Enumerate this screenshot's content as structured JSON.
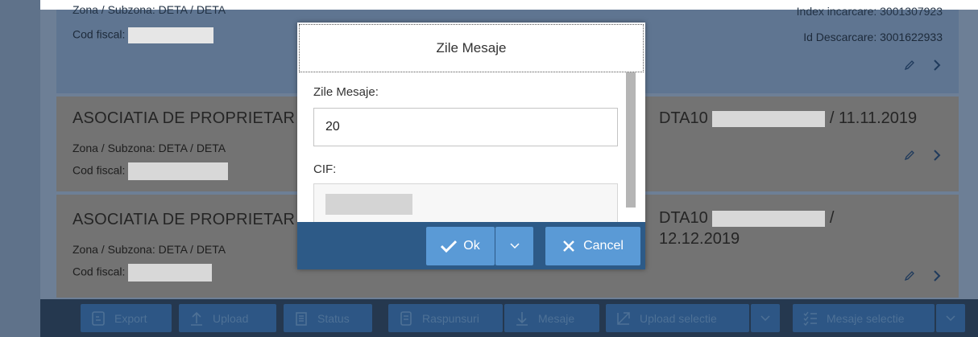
{
  "colors": {
    "dim_overlay": "#737373",
    "selected_row": "#5f7591",
    "footer_bg": "#25384f",
    "dialog_footer": "#2d5a87",
    "button_primary": "#5a9ad6"
  },
  "list": {
    "row1": {
      "zona": "Zona / Subzona: DETA / DETA",
      "cod_fiscal_label": "Cod fiscal:",
      "index_incarcare": "Index incarcare: 3001307923",
      "id_descarcare": "Id Descarcare: 3001622933"
    },
    "row2": {
      "title": "ASOCIATIA DE PROPRIETAR",
      "zona": "Zona / Subzona: DETA / DETA",
      "cod_fiscal_label": "Cod fiscal:",
      "doc_prefix": "DTA10",
      "doc_suffix": "/ 11.11.2019"
    },
    "row3": {
      "title": "ASOCIATIA DE PROPRIETAR",
      "zona": "Zona / Subzona: DETA / DETA",
      "cod_fiscal_label": "Cod fiscal:",
      "doc_prefix": "DTA10",
      "doc_suffix": "/",
      "doc_date": "12.12.2019"
    }
  },
  "dialog": {
    "title": "Zile Mesaje",
    "zile_label": "Zile Mesaje:",
    "zile_value": "20",
    "cif_label": "CIF:",
    "ok_label": "Ok",
    "cancel_label": "Cancel"
  },
  "footer": {
    "export": "Export",
    "upload": "Upload",
    "status": "Status",
    "raspunsuri": "Raspunsuri",
    "mesaje": "Mesaje",
    "upload_selectie": "Upload selectie",
    "mesaje_selectie": "Mesaje selectie"
  }
}
